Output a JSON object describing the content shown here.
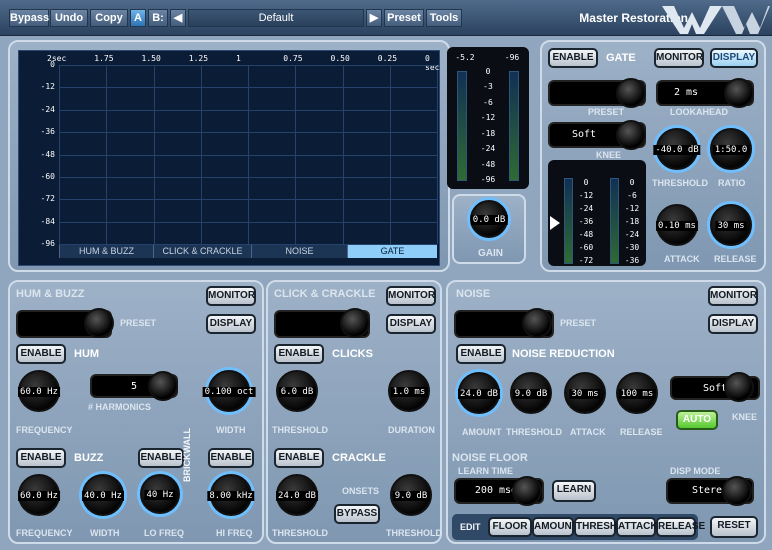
{
  "topbar": {
    "bypass": "Bypass",
    "undo": "Undo",
    "copy": "Copy",
    "ab": "A",
    "b": "B:",
    "prev": "◀",
    "preset_name": "Default",
    "next": "▶",
    "preset": "Preset",
    "tools": "Tools",
    "brand": "Master Restoration"
  },
  "graph": {
    "x_ticks": [
      "2sec",
      "1.75",
      "1.50",
      "1.25",
      "1",
      "0.75",
      "0.50",
      "0.25",
      "0 sec"
    ],
    "y_ticks": [
      "0",
      "-12",
      "-24",
      "-36",
      "-48",
      "-60",
      "-72",
      "-84",
      "-96"
    ],
    "tabs": [
      "HUM & BUZZ",
      "CLICK & CRACKLE",
      "NOISE",
      "GATE"
    ]
  },
  "gain": {
    "left_peak": "-5.2",
    "right_peak": "-96",
    "ticks": [
      "0",
      "-3",
      "-6",
      "-12",
      "-18",
      "-24",
      "-48",
      "-96"
    ],
    "value": "0.0 dB",
    "label": "GAIN",
    "level_left": 0.0,
    "level_right": 0.75
  },
  "gate": {
    "enable": "ENABLE",
    "title": "GATE",
    "monitor": "MONITOR",
    "display": "DISPLAY",
    "preset_label": "PRESET",
    "lookahead_value": "2 ms",
    "lookahead_label": "LOOKAHEAD",
    "knee_value": "Soft",
    "knee_label": "KNEE",
    "threshold_value": "-40.0 dB",
    "threshold_label": "THRESHOLD",
    "ratio_value": "1:50.0",
    "ratio_label": "RATIO",
    "attack_value": "0.10 ms",
    "attack_label": "ATTACK",
    "release_value": "30 ms",
    "release_label": "RELEASE",
    "meter_ticks_left": [
      "0",
      "-12",
      "-24",
      "-36",
      "-48",
      "-60",
      "-72"
    ],
    "meter_ticks_right": [
      "0",
      "-6",
      "-12",
      "-18",
      "-24",
      "-30",
      "-36"
    ]
  },
  "hum": {
    "section": "HUM & BUZZ",
    "monitor": "MONITOR",
    "display": "DISPLAY",
    "preset_label": "PRESET",
    "enable": "ENABLE",
    "title": "HUM",
    "harmonics_value": "5",
    "harmonics_label": "# HARMONICS",
    "frequency_value": "60.0 Hz",
    "frequency_label": "FREQUENCY",
    "width_value": "0.100 oct",
    "width_label": "WIDTH"
  },
  "buzz": {
    "enable": "ENABLE",
    "title": "BUZZ",
    "freq_value": "60.0 Hz",
    "freq_label": "FREQUENCY",
    "width_value": "40.0 Hz",
    "width_label": "WIDTH",
    "bw_enable1": "ENABLE",
    "bw_enable2": "ENABLE",
    "brickwall": "BRICKWALL",
    "lo_value": "40 Hz",
    "lo_label": "LO FREQ",
    "hi_value": "8.00 kHz",
    "hi_label": "HI FREQ"
  },
  "click": {
    "section": "CLICK & CRACKLE",
    "monitor": "MONITOR",
    "display": "DISPLAY",
    "enable": "ENABLE",
    "title": "CLICKS",
    "threshold_value": "6.0 dB",
    "threshold_label": "THRESHOLD",
    "duration_value": "1.0 ms",
    "duration_label": "DURATION",
    "crackle_enable": "ENABLE",
    "crackle_title": "CRACKLE",
    "crackle_value": "24.0 dB",
    "crackle_label": "THRESHOLD",
    "onsets": "ONSETS",
    "bypass": "BYPASS",
    "onset_value": "9.0 dB",
    "onset_label": "THRESHOLD"
  },
  "noise": {
    "section": "NOISE",
    "monitor": "MONITOR",
    "display": "DISPLAY",
    "preset_label": "PRESET",
    "enable": "ENABLE",
    "title": "NOISE REDUCTION",
    "amount_value": "24.0 dB",
    "amount_label": "AMOUNT",
    "threshold_value": "9.0 dB",
    "threshold_label": "THRESHOLD",
    "attack_value": "30 ms",
    "attack_label": "ATTACK",
    "release_value": "100 ms",
    "release_label": "RELEASE",
    "knee_value": "Soft",
    "knee_label": "KNEE",
    "auto": "AUTO",
    "floor_title": "NOISE FLOOR",
    "learn_time_label": "LEARN TIME",
    "learn_time_value": "200 msec",
    "learn": "LEARN",
    "disp_mode_label": "DISP MODE",
    "disp_mode_value": "Stereo",
    "edit": "EDIT",
    "floor": "FLOOR",
    "amount": "AMOUNT",
    "thresh": "THRESH",
    "attack": "ATTACK",
    "release": "RELEASE",
    "reset": "RESET"
  }
}
